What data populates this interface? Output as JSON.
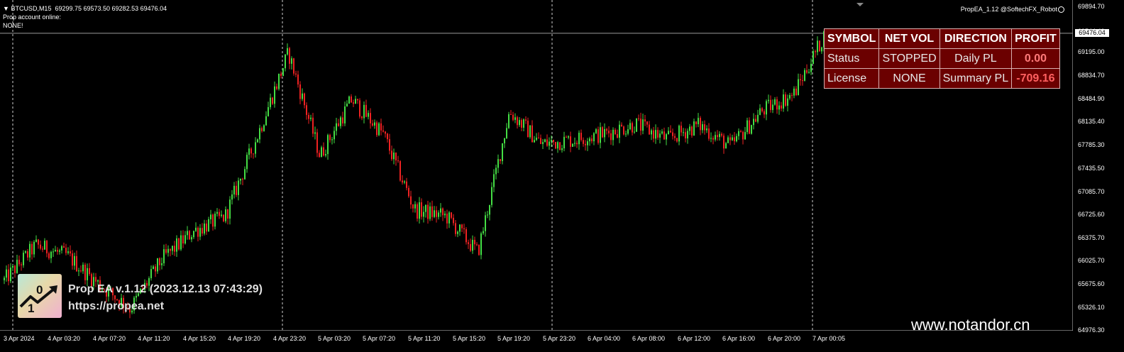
{
  "symbol_info": {
    "arrow": "▼",
    "symbol": "BTCUSD,M15",
    "ohlc": "69299.75 69573.50 69282.53 69476.04",
    "line2": "Prop account online:",
    "line3": "NONE!"
  },
  "ea_name": "PropEA_1.12 @SoftechFX_Robot",
  "price_scale": {
    "current": "69476.04",
    "labels": [
      "69894.70",
      "69544.40",
      "69195.00",
      "68834.70",
      "68484.90",
      "68135.40",
      "67785.30",
      "67435.50",
      "67085.70",
      "66725.60",
      "66375.70",
      "66025.70",
      "65675.60",
      "65326.10",
      "64976.30"
    ]
  },
  "time_axis": [
    "3 Apr 2024",
    "4 Apr 03:20",
    "4 Apr 07:20",
    "4 Apr 11:20",
    "4 Apr 15:20",
    "4 Apr 19:20",
    "4 Apr 23:20",
    "5 Apr 03:20",
    "5 Apr 07:20",
    "5 Apr 11:20",
    "5 Apr 15:20",
    "5 Apr 19:20",
    "5 Apr 23:20",
    "6 Apr 04:00",
    "6 Apr 08:00",
    "6 Apr 12:00",
    "6 Apr 16:00",
    "6 Apr 20:00",
    "7 Apr 00:05"
  ],
  "stats_table": {
    "headers": [
      "SYMBOL",
      "NET VOL",
      "DIRECTION",
      "PROFIT"
    ],
    "rows": [
      [
        "Status",
        "STOPPED",
        "Daily PL",
        "0.00"
      ],
      [
        "License",
        "NONE",
        "Summary PL",
        "-709.16"
      ]
    ]
  },
  "logo_glyphs": {
    "top": "0",
    "bottom": "1"
  },
  "ea_title": "Prop EA v.1.12 (2023.12.13 07:43:29)",
  "ea_url": "https://propea.net",
  "watermark": "www.notandor.cn",
  "colors": {
    "bull": "#44dd44",
    "bear": "#ee2222",
    "background": "#000000",
    "grid": "#cccccc",
    "table_bg": "#6b0000"
  },
  "chart_data": {
    "type": "candlestick",
    "symbol": "BTCUSD",
    "timeframe": "M15",
    "ylim": [
      64976.3,
      69894.7
    ],
    "x": [
      "3 Apr 2024",
      "4 Apr 03:20",
      "4 Apr 07:20",
      "4 Apr 11:20",
      "4 Apr 15:20",
      "4 Apr 19:20",
      "4 Apr 23:20",
      "5 Apr 03:20",
      "5 Apr 07:20",
      "5 Apr 11:20",
      "5 Apr 15:20",
      "5 Apr 19:20",
      "5 Apr 23:20",
      "6 Apr 04:00",
      "6 Apr 08:00",
      "6 Apr 12:00",
      "6 Apr 16:00",
      "6 Apr 20:00",
      "7 Apr 00:05"
    ],
    "close_path": [
      65730,
      66260,
      66100,
      65670,
      65300,
      66050,
      66480,
      66700,
      67900,
      69180,
      67620,
      68470,
      67950,
      66800,
      66700,
      66150,
      68290,
      67800,
      67860,
      67950,
      68100,
      67870,
      68090,
      67760,
      68300,
      68550,
      69476.04
    ],
    "last_close": 69476.04,
    "grid": true
  }
}
